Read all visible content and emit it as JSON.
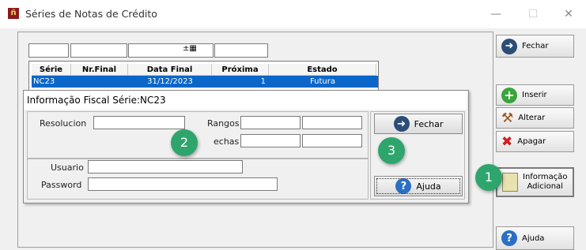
{
  "window": {
    "title": "Séries de Notas de Crédito",
    "minimize": "—",
    "maximize": "☐",
    "close": "✕"
  },
  "filters": {
    "cal_glyph": "±▦"
  },
  "grid": {
    "headers": [
      "Série",
      "Nr.Final",
      "Data Final",
      "Próxima",
      "Estado"
    ],
    "rows": [
      {
        "serie": "NC23",
        "nr_final": "",
        "data_final": "31/12/2023",
        "proxima": "1",
        "estado": "Futura"
      }
    ]
  },
  "panel": {
    "title": "Informação Fiscal Série:NC23",
    "resolucion_label": "Resolucion",
    "rangos_label": "Rangos",
    "fechas_label": "echas",
    "usuario_label": "Usuario",
    "password_label": "Password",
    "fechar_label": "Fechar",
    "ajuda_label": "Ajuda"
  },
  "sidebar": {
    "fechar": "Fechar",
    "inserir": "Inserir",
    "alterar": "Alterar",
    "apagar": "Apagar",
    "info_line1": "Informação",
    "info_line2": "Adicional",
    "ajuda": "Ajuda"
  },
  "callouts": [
    "1",
    "2",
    "3"
  ],
  "colors": {
    "selection": "#0a66c8",
    "badge": "#2ea56d"
  }
}
